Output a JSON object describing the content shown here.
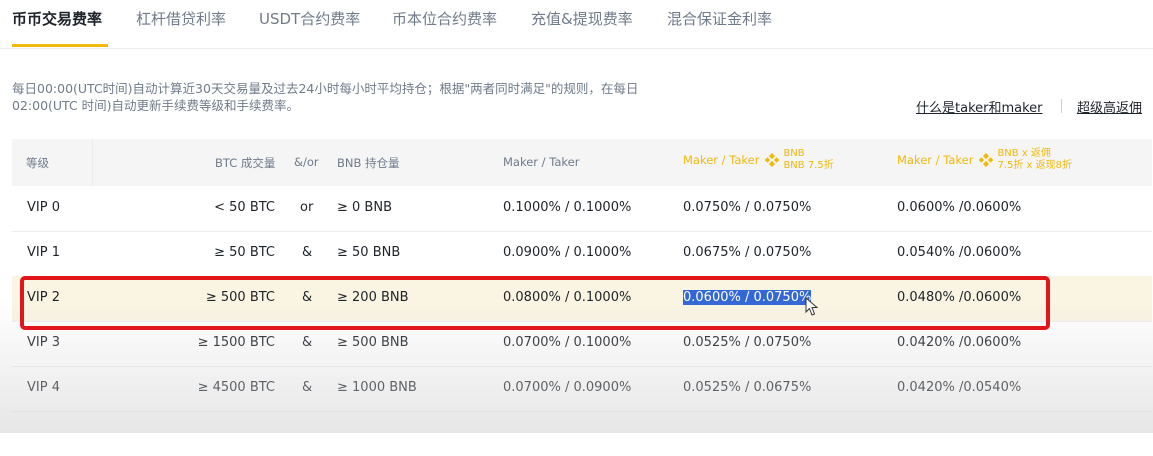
{
  "tabs": [
    {
      "label": "币币交易费率",
      "active": true
    },
    {
      "label": "杠杆借贷利率",
      "active": false
    },
    {
      "label": "USDT合约费率",
      "active": false
    },
    {
      "label": "币本位合约费率",
      "active": false
    },
    {
      "label": "充值&提现费率",
      "active": false
    },
    {
      "label": "混合保证金利率",
      "active": false
    }
  ],
  "description": {
    "line1": "每日00:00(UTC时间)自动计算近30天交易量及过去24小时每小时平均持仓；根据\"两者同时满足\"的规则，在每日",
    "line2": "02:00(UTC 时间)自动更新手续费等级和手续费率。"
  },
  "links": {
    "taker_maker": "什么是taker和maker",
    "advanced_rebate": "超级高返佣"
  },
  "table": {
    "headers": {
      "level": "等级",
      "btc_volume": "BTC 成交量",
      "andor": "&/or",
      "bnb_balance": "BNB 持仓量",
      "maker_taker": "Maker / Taker",
      "maker_taker_bnb": "Maker / Taker",
      "bnb_line1": "BNB",
      "bnb_line2": "BNB 7.5折",
      "maker_taker_bnb_rebate": "Maker / Taker",
      "rebate_line1": "BNB x 返佣",
      "rebate_line2": "7.5折 x 返现8折"
    },
    "rows": [
      {
        "level": "VIP 0",
        "btc": "< 50 BTC",
        "op": "or",
        "bnb": "≥ 0 BNB",
        "mt": "0.1000% / 0.1000%",
        "mt_bnb": "0.0750% / 0.0750%",
        "mt_rebate": "0.0600% /0.0600%"
      },
      {
        "level": "VIP 1",
        "btc": "≥ 50 BTC",
        "op": "&",
        "bnb": "≥ 50 BNB",
        "mt": "0.0900% / 0.1000%",
        "mt_bnb": "0.0675% / 0.0750%",
        "mt_rebate": "0.0540% /0.0600%"
      },
      {
        "level": "VIP 2",
        "btc": "≥ 500 BTC",
        "op": "&",
        "bnb": "≥ 200 BNB",
        "mt": "0.0800% / 0.1000%",
        "mt_bnb": "0.0600% / 0.0750%",
        "mt_rebate": "0.0480% /0.0600%"
      },
      {
        "level": "VIP 3",
        "btc": "≥ 1500 BTC",
        "op": "&",
        "bnb": "≥ 500 BNB",
        "mt": "0.0700% / 0.1000%",
        "mt_bnb": "0.0525% / 0.0750%",
        "mt_rebate": "0.0420% /0.0600%"
      },
      {
        "level": "VIP 4",
        "btc": "≥ 4500 BTC",
        "op": "&",
        "bnb": "≥ 1000 BNB",
        "mt": "0.0700% / 0.0900%",
        "mt_bnb": "0.0525% / 0.0675%",
        "mt_rebate": "0.0420% /0.0540%"
      }
    ]
  },
  "colors": {
    "accent": "#f0b90b",
    "highlight_row": "#faf4e3",
    "annotation_box": "#e0161b",
    "text_selection": "#3367d6"
  }
}
